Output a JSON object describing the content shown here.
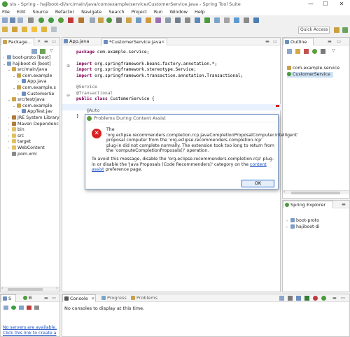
{
  "window": {
    "title": "sts - Spring - hajiboot-di/src/main/java/com/example/service/CustomerService.java - Spring Tool Suite",
    "minimize": "—",
    "maximize": "☐",
    "close": "✕"
  },
  "menu": [
    "File",
    "Edit",
    "Source",
    "Refactor",
    "Navigate",
    "Search",
    "Project",
    "Run",
    "Window",
    "Help"
  ],
  "quick_access": "Quick Access",
  "package_explorer": {
    "tab_label": "Package...",
    "items": [
      {
        "label": "boot-proto [boot]",
        "level": 0,
        "icon": "project-icon"
      },
      {
        "label": "hajiboot-di [boot]",
        "level": 0,
        "icon": "project-icon"
      },
      {
        "label": "src/main/java",
        "level": 1,
        "icon": "source-folder-icon"
      },
      {
        "label": "com.example",
        "level": 2,
        "icon": "package-icon"
      },
      {
        "label": "App.java",
        "level": 3,
        "icon": "java-file-icon"
      },
      {
        "label": "com.example.s",
        "level": 2,
        "icon": "package-icon"
      },
      {
        "label": "CustomerSe",
        "level": 3,
        "icon": "java-file-icon"
      },
      {
        "label": "src/test/java",
        "level": 1,
        "icon": "source-folder-icon"
      },
      {
        "label": "com.example",
        "level": 2,
        "icon": "package-icon"
      },
      {
        "label": "AppTest.jav",
        "level": 3,
        "icon": "java-file-icon"
      },
      {
        "label": "JRE System Library",
        "level": 1,
        "icon": "library-icon"
      },
      {
        "label": "Maven Dependenc",
        "level": 1,
        "icon": "library-icon"
      },
      {
        "label": "bin",
        "level": 1,
        "icon": "folder-icon"
      },
      {
        "label": "src",
        "level": 1,
        "icon": "folder-icon"
      },
      {
        "label": "target",
        "level": 1,
        "icon": "folder-icon"
      },
      {
        "label": "WebContent",
        "level": 1,
        "icon": "folder-icon"
      },
      {
        "label": "pom.xml",
        "level": 1,
        "icon": "xml-file-icon"
      }
    ]
  },
  "editor": {
    "tabs": [
      {
        "label": "App.java",
        "active": false
      },
      {
        "label": "*CustomerService.java",
        "active": true
      }
    ],
    "lines": [
      {
        "indent": "",
        "parts": [
          {
            "t": "package",
            "c": "kw"
          },
          {
            "t": " com.example.service;",
            "c": ""
          }
        ]
      },
      {
        "indent": "",
        "parts": []
      },
      {
        "indent": "",
        "parts": [
          {
            "t": "import",
            "c": "kw"
          },
          {
            "t": " org.springframework.beans.factory.annotation.*;",
            "c": ""
          }
        ]
      },
      {
        "indent": "",
        "parts": [
          {
            "t": "import",
            "c": "kw"
          },
          {
            "t": " org.springframework.stereotype.Service;",
            "c": ""
          }
        ]
      },
      {
        "indent": "",
        "parts": [
          {
            "t": "import",
            "c": "kw"
          },
          {
            "t": " org.springframework.transaction.annotation.Transactional;",
            "c": ""
          }
        ]
      },
      {
        "indent": "",
        "parts": []
      },
      {
        "indent": "",
        "parts": [
          {
            "t": "@Service",
            "c": "ann"
          }
        ]
      },
      {
        "indent": "",
        "parts": [
          {
            "t": "@Transactional",
            "c": "ann"
          }
        ]
      },
      {
        "indent": "",
        "parts": [
          {
            "t": "public class",
            "c": "kw"
          },
          {
            "t": " CustomerService {",
            "c": ""
          }
        ]
      },
      {
        "indent": "",
        "parts": []
      },
      {
        "indent": "    ",
        "parts": [
          {
            "t": "@Auto",
            "c": "ann"
          }
        ]
      },
      {
        "indent": "",
        "parts": [
          {
            "t": "}",
            "c": ""
          }
        ]
      }
    ]
  },
  "outline": {
    "tab_label": "Outline",
    "items": [
      {
        "label": "com.example.service",
        "icon": "package-icon"
      },
      {
        "label": "CustomerService",
        "icon": "class-icon"
      }
    ]
  },
  "spring_explorer": {
    "tab_label": "Spring Explorer",
    "items": [
      "boot-proto",
      "hajiboot-di"
    ]
  },
  "servers": {
    "tab_s": "S",
    "tab_b": "B",
    "line1": "No servers are available.",
    "line2": "Click this link to create a"
  },
  "console": {
    "tabs": [
      "Console",
      "Progress",
      "Problems"
    ],
    "message": "No consoles to display at this time."
  },
  "dialog": {
    "title": "Problems During Content Assist",
    "message": "The 'org.eclipse.recommenders.completion.rcp.javaCompletionProposalComputer.intelligent' proposal computer from the 'org.eclipse.recommenders.completion.rcp' plug-in did not complete normally. The extension took too long to return from the 'computeCompletionProposals()' operation.",
    "advice_before": "To avoid this message, disable the 'org.eclipse.recommenders.completion.rcp' plug-in or disable the 'Java Proposals (Code Recommenders)' category on the ",
    "advice_link": "content assist",
    "advice_after": " preference page.",
    "ok": "OK"
  },
  "colors": {
    "keyword": "#7f0055",
    "annotation": "#646464",
    "error": "#d82020",
    "link": "#1a4ec4",
    "spring_green": "#4b9a3c"
  }
}
